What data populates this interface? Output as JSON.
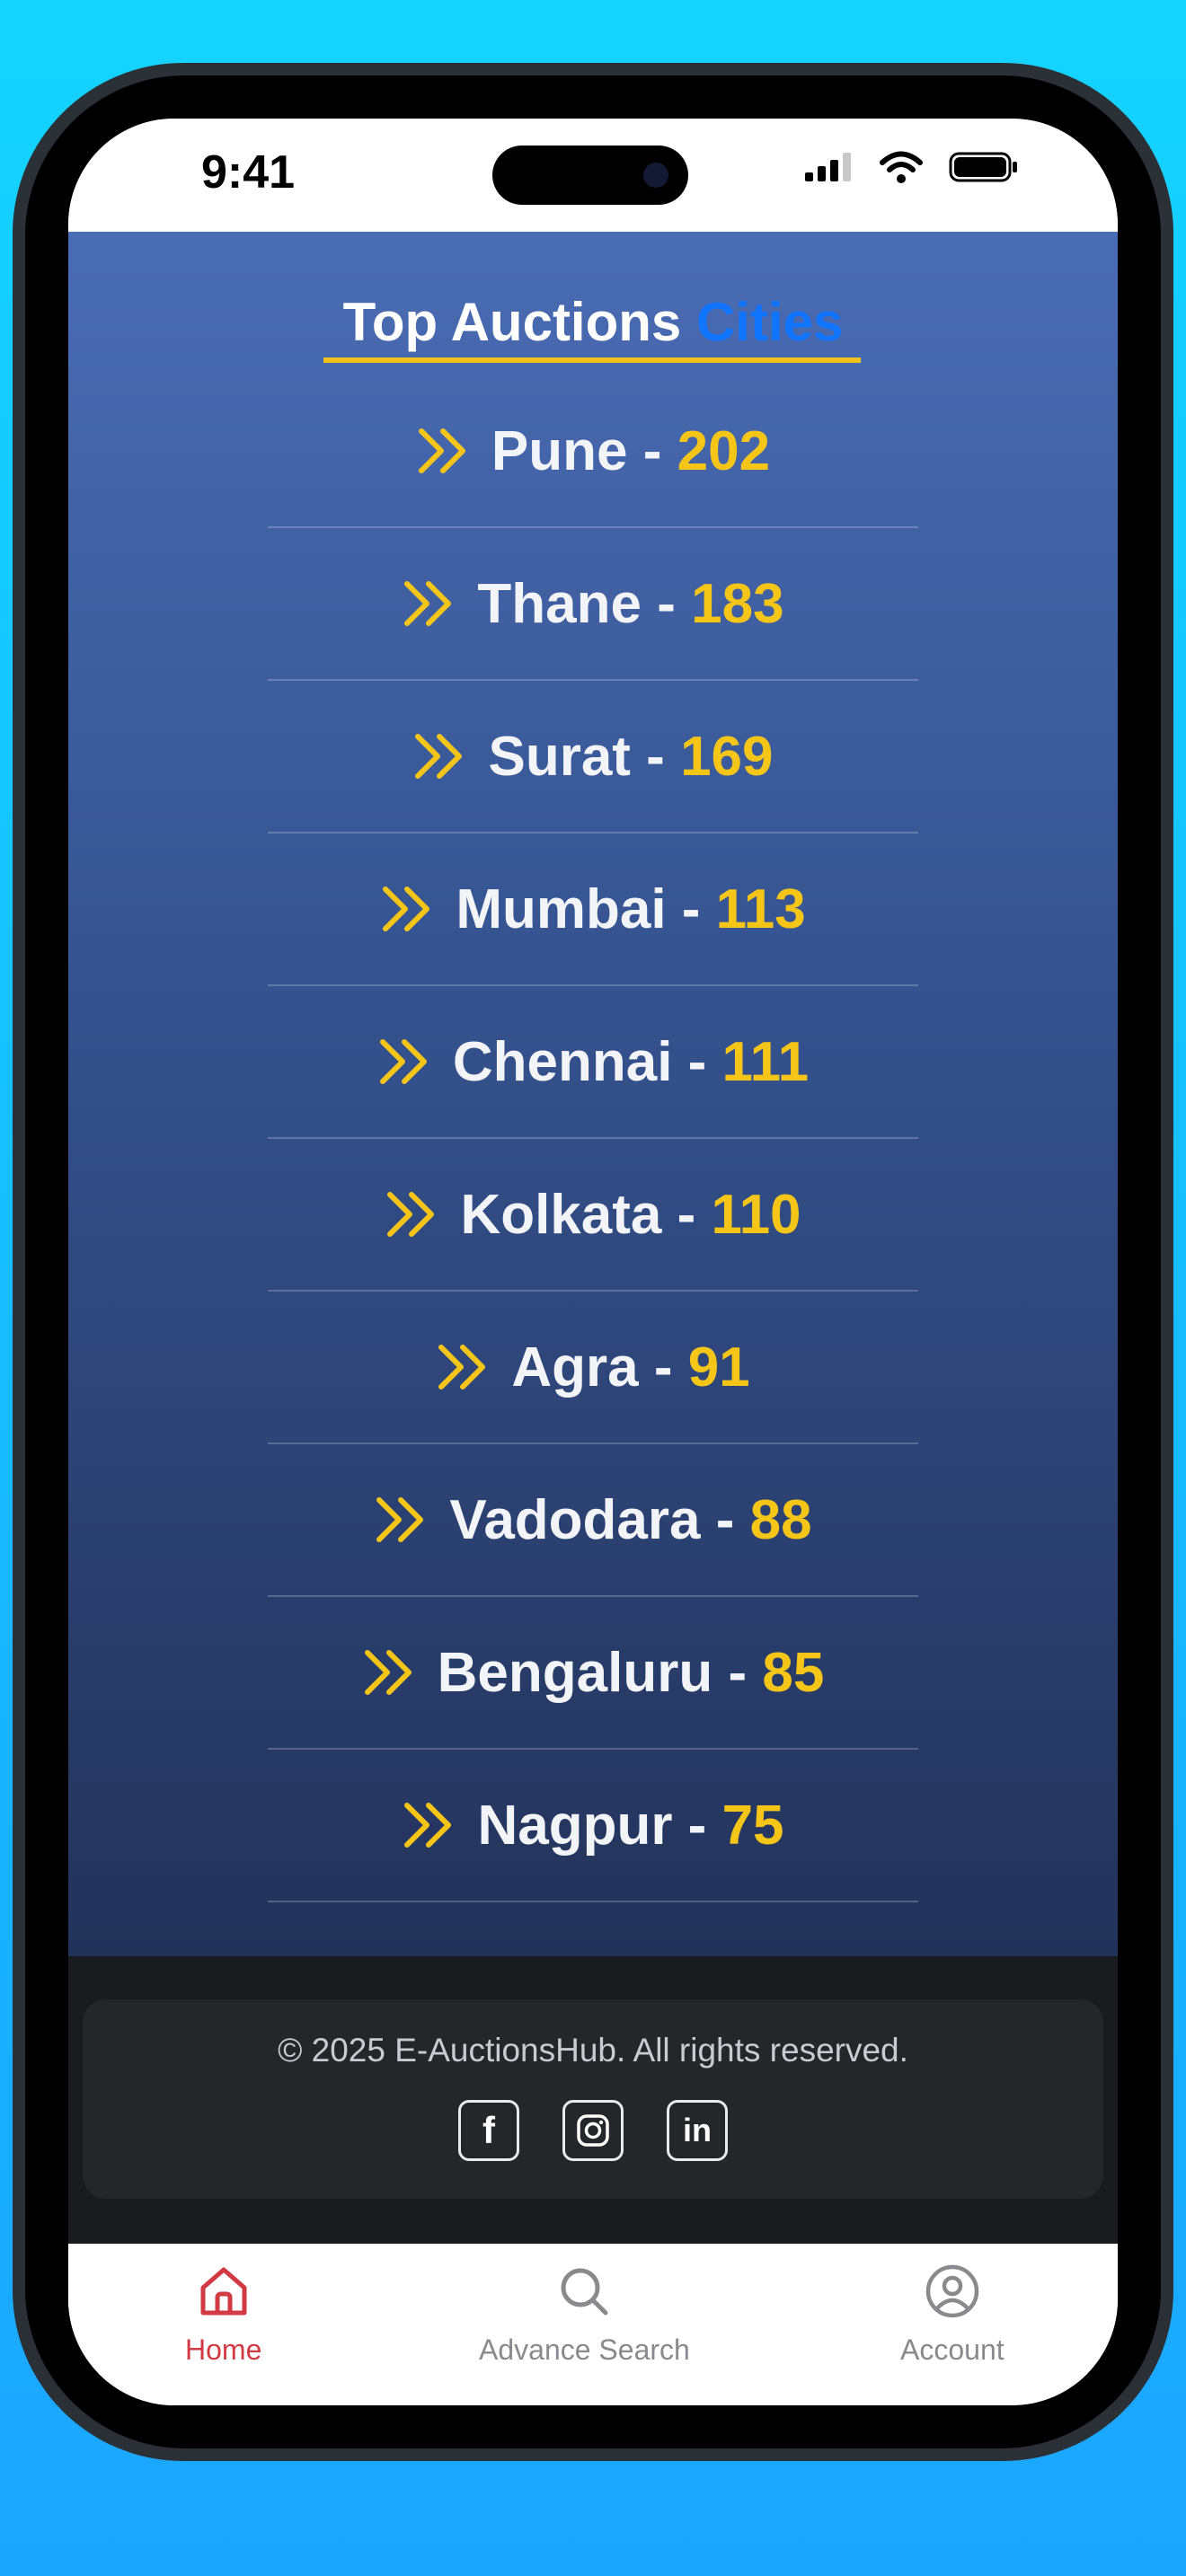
{
  "status_bar": {
    "time": "9:41"
  },
  "section": {
    "title_main": "Top Auctions",
    "title_accent": "Cities"
  },
  "cities": [
    {
      "name": "Pune",
      "separator": " - ",
      "count": "202"
    },
    {
      "name": "Thane",
      "separator": " - ",
      "count": "183"
    },
    {
      "name": "Surat",
      "separator": " - ",
      "count": "169"
    },
    {
      "name": "Mumbai",
      "separator": " - ",
      "count": "113"
    },
    {
      "name": "Chennai",
      "separator": " - ",
      "count": "111"
    },
    {
      "name": "Kolkata",
      "separator": " - ",
      "count": "110"
    },
    {
      "name": "Agra",
      "separator": " - ",
      "count": "91"
    },
    {
      "name": "Vadodara",
      "separator": " - ",
      "count": "88"
    },
    {
      "name": "Bengaluru",
      "separator": " - ",
      "count": "85"
    },
    {
      "name": "Nagpur",
      "separator": " - ",
      "count": "75"
    }
  ],
  "footer": {
    "copyright": "© 2025 E-AuctionsHub. All rights reserved.",
    "socials": [
      {
        "icon": "facebook-icon",
        "glyph": "f"
      },
      {
        "icon": "instagram-icon",
        "glyph": ""
      },
      {
        "icon": "linkedin-icon",
        "glyph": "in"
      }
    ]
  },
  "nav": {
    "home_label": "Home",
    "search_label": "Advance Search",
    "account_label": "Account",
    "active": "Home"
  },
  "colors": {
    "accent_blue": "#0f74ff",
    "count_yellow": "#f5c518",
    "active_nav": "#d23a43",
    "inactive_nav": "#8a8a8e"
  }
}
